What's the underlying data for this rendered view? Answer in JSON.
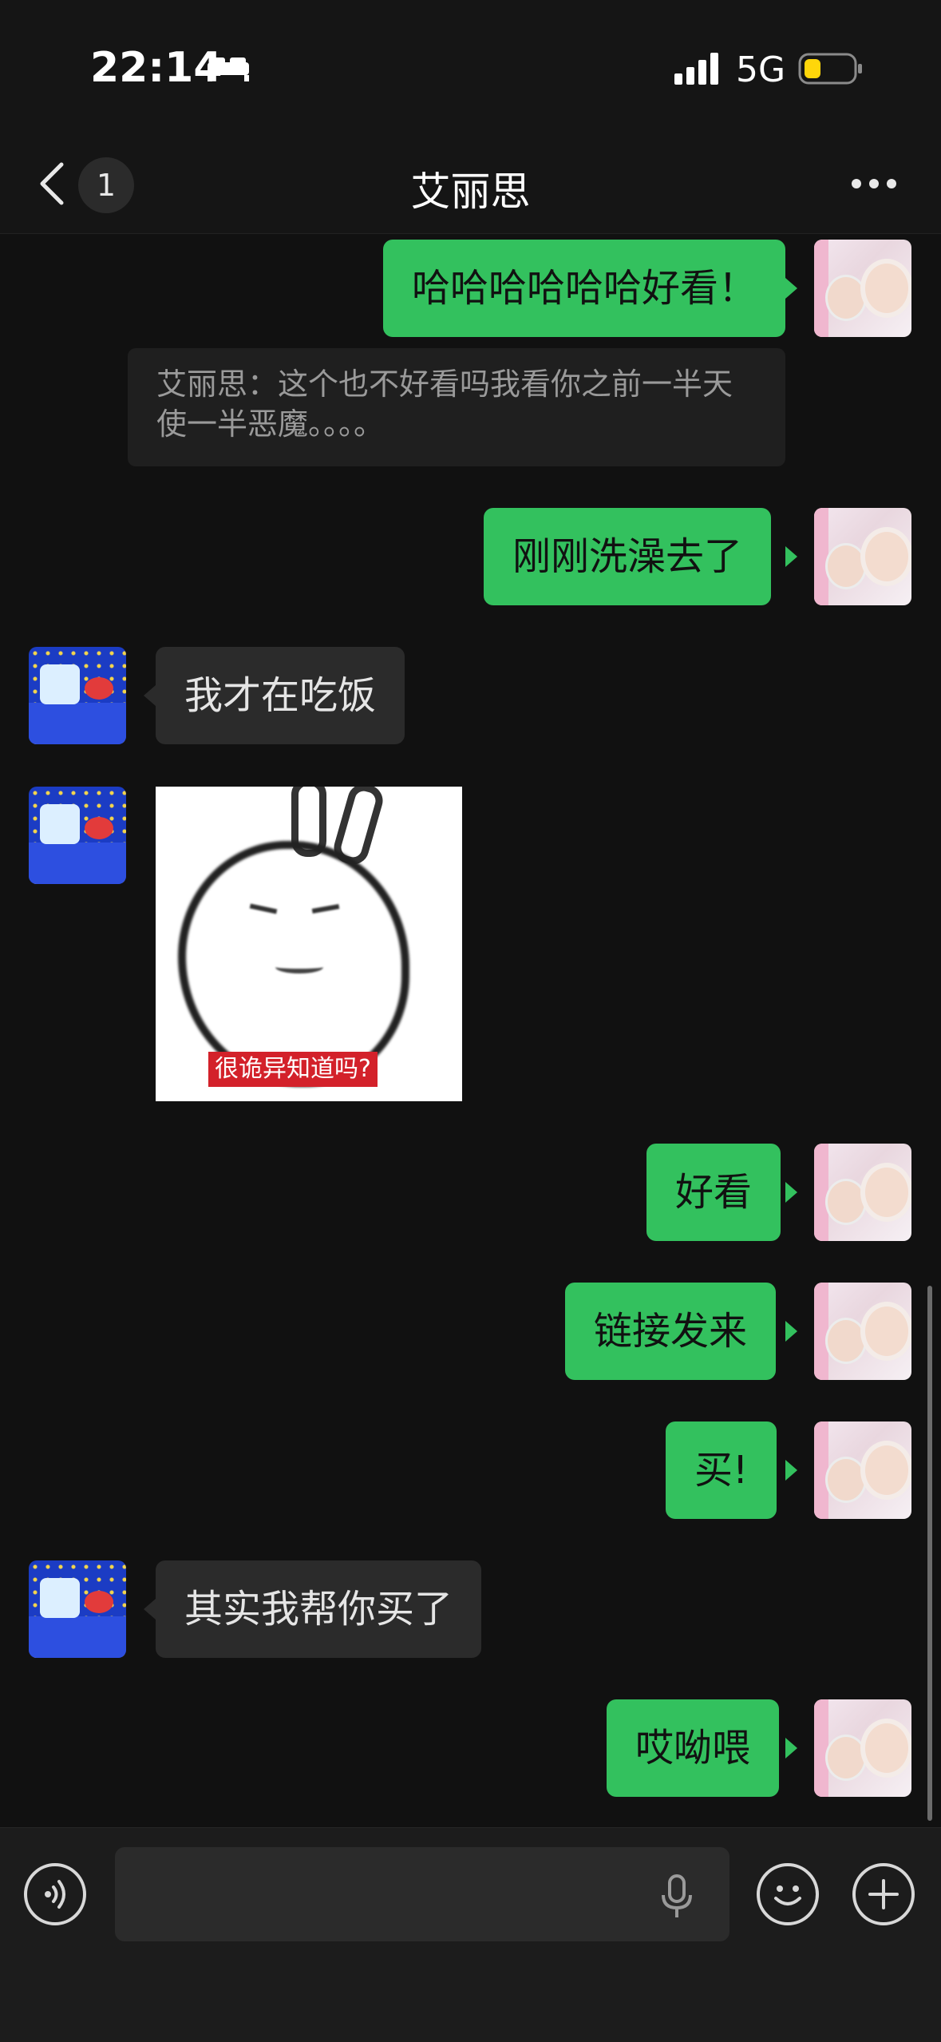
{
  "status": {
    "time": "22:14",
    "network": "5G",
    "icons": [
      "bed-icon",
      "cellular-signal-icon",
      "battery-low-icon"
    ],
    "battery_color": "#ffd60a"
  },
  "nav": {
    "unread_count": "1",
    "title": "艾丽思",
    "icons": [
      "chevron-left-icon",
      "more-dots-icon"
    ]
  },
  "messages": [
    {
      "from": "me",
      "type": "text",
      "text": "哈哈哈哈哈哈好看！"
    },
    {
      "from": "quote",
      "type": "quote",
      "text": "艾丽思：这个也不好看吗我看你之前一半天使一半恶魔。。。。"
    },
    {
      "from": "me",
      "type": "text",
      "text": "刚刚洗澡去了"
    },
    {
      "from": "them",
      "type": "text",
      "text": "我才在吃饭"
    },
    {
      "from": "them",
      "type": "sticker",
      "caption": "很诡异知道吗?"
    },
    {
      "from": "me",
      "type": "text",
      "text": "好看"
    },
    {
      "from": "me",
      "type": "text",
      "text": "链接发来"
    },
    {
      "from": "me",
      "type": "text",
      "text": "买!"
    },
    {
      "from": "them",
      "type": "text",
      "text": "其实我帮你买了"
    },
    {
      "from": "me",
      "type": "text",
      "text": "哎呦喂"
    }
  ],
  "colors": {
    "background": "#111111",
    "outgoing_bubble": "#33c15e",
    "incoming_bubble": "#2b2b2b"
  },
  "input": {
    "icons": [
      "voice-input-icon",
      "microphone-icon",
      "emoji-icon",
      "plus-icon"
    ]
  }
}
